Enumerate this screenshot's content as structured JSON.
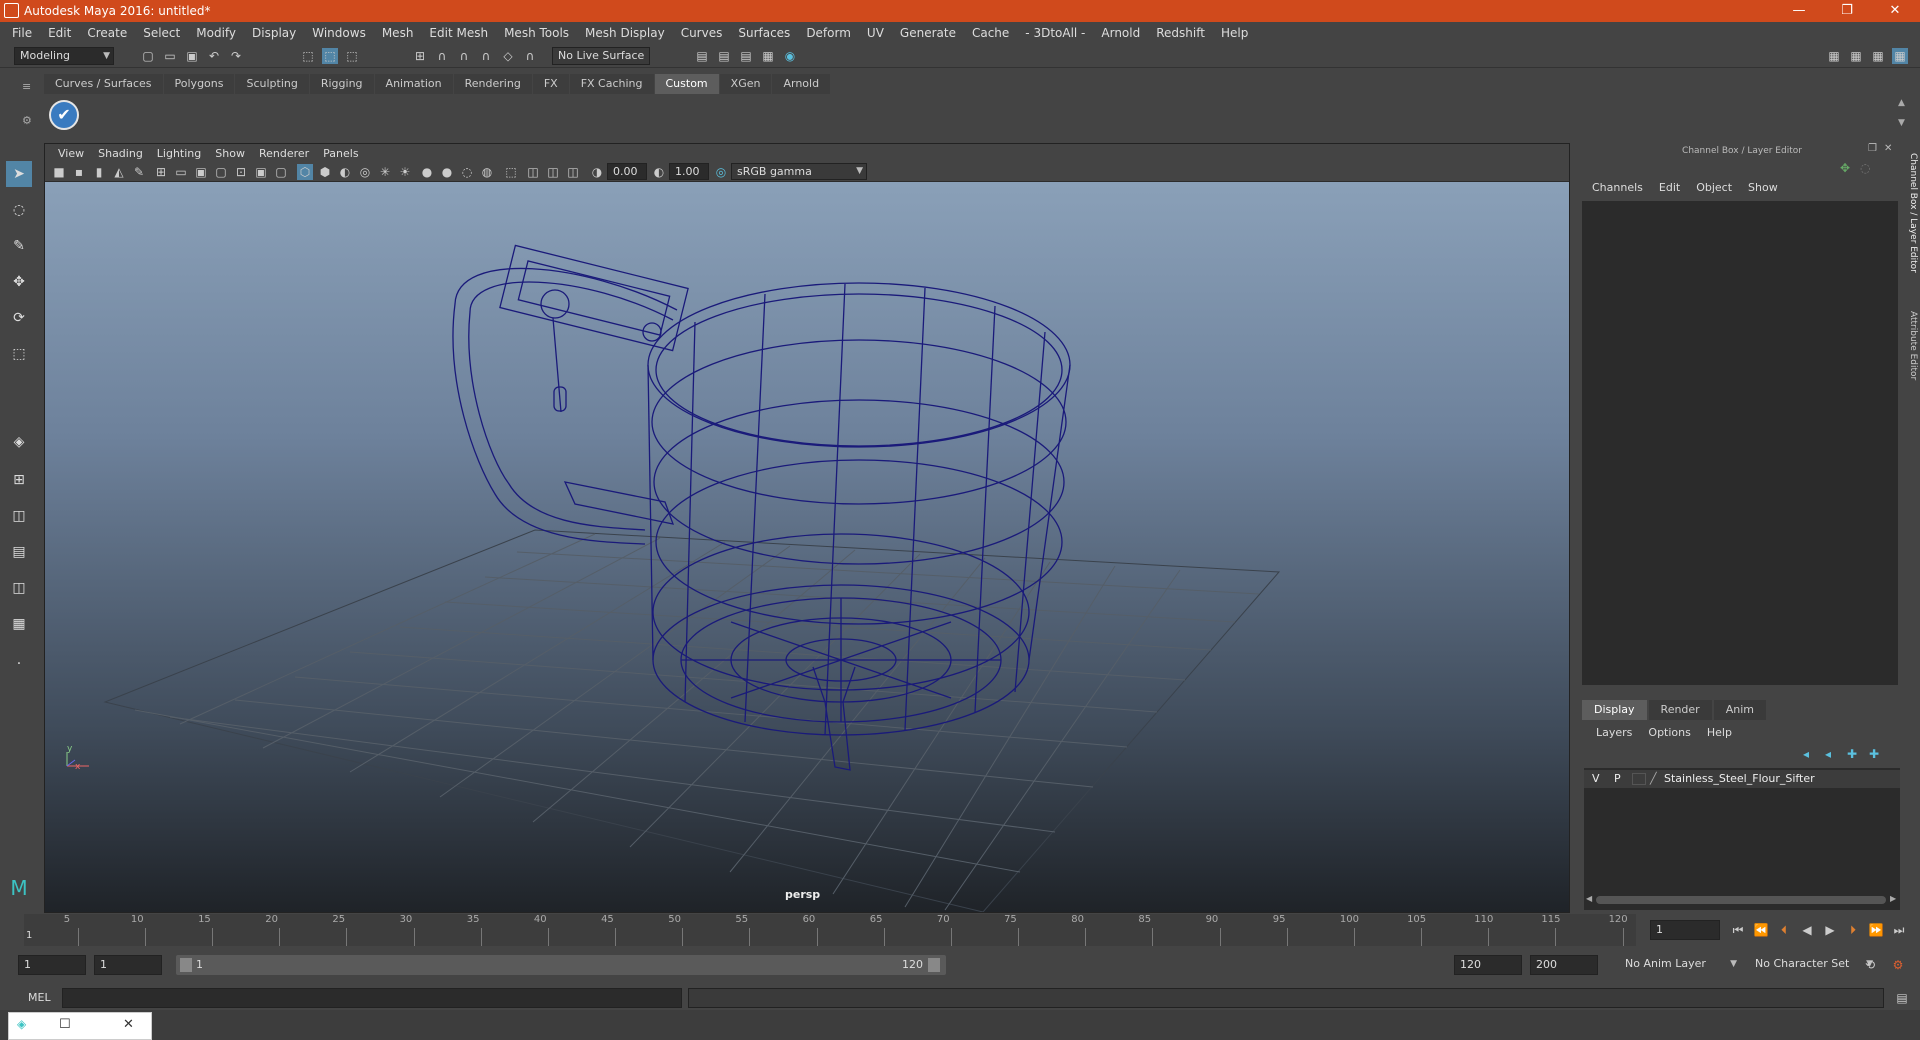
{
  "window": {
    "title": "Autodesk Maya 2016: untitled*",
    "minimize": "—",
    "restore": "❐",
    "close": "✕"
  },
  "menubar": [
    "File",
    "Edit",
    "Create",
    "Select",
    "Modify",
    "Display",
    "Windows",
    "Mesh",
    "Edit Mesh",
    "Mesh Tools",
    "Mesh Display",
    "Curves",
    "Surfaces",
    "Deform",
    "UV",
    "Generate",
    "Cache",
    "- 3DtoAll -",
    "Arnold",
    "Redshift",
    "Help"
  ],
  "statusline": {
    "mode": "Modeling",
    "live_surface": "No Live Surface"
  },
  "shelf": {
    "tabs": [
      "Curves / Surfaces",
      "Polygons",
      "Sculpting",
      "Rigging",
      "Animation",
      "Rendering",
      "FX",
      "FX Caching",
      "Custom",
      "XGen",
      "Arnold"
    ],
    "active_tab": "Custom",
    "icon": "check-icon"
  },
  "viewport": {
    "menu": [
      "View",
      "Shading",
      "Lighting",
      "Show",
      "Renderer",
      "Panels"
    ],
    "exposure": "0.00",
    "gamma": "1.00",
    "color_space": "sRGB gamma",
    "camera": "persp",
    "axis_y": "y",
    "axis_x": "x"
  },
  "channel_box": {
    "title": "Channel Box / Layer Editor",
    "menu": [
      "Channels",
      "Edit",
      "Object",
      "Show"
    ]
  },
  "layer_editor": {
    "tabs": [
      "Display",
      "Render",
      "Anim"
    ],
    "active_tab": "Display",
    "menu": [
      "Layers",
      "Options",
      "Help"
    ],
    "layer": {
      "v": "V",
      "p": "P",
      "name": "Stainless_Steel_Flour_Sifter"
    }
  },
  "side_tabs": [
    "Channel Box / Layer Editor",
    "Attribute Editor"
  ],
  "timeline": {
    "ticks": [
      "5",
      "10",
      "15",
      "20",
      "25",
      "30",
      "35",
      "40",
      "45",
      "50",
      "55",
      "60",
      "65",
      "70",
      "75",
      "80",
      "85",
      "90",
      "95",
      "100",
      "105",
      "110",
      "115",
      "120"
    ],
    "current_frame": "1",
    "start_label": "1"
  },
  "range": {
    "start": "1",
    "playback_start": "1",
    "slider_start": "1",
    "slider_end": "120",
    "playback_end": "120",
    "end": "200",
    "anim_layer": "No Anim Layer",
    "char_set": "No Character Set"
  },
  "cmdline": {
    "label": "MEL"
  },
  "colors": {
    "titlebar": "#d04a1c",
    "wire": "#1a1a7a",
    "active": "#5285a6"
  }
}
